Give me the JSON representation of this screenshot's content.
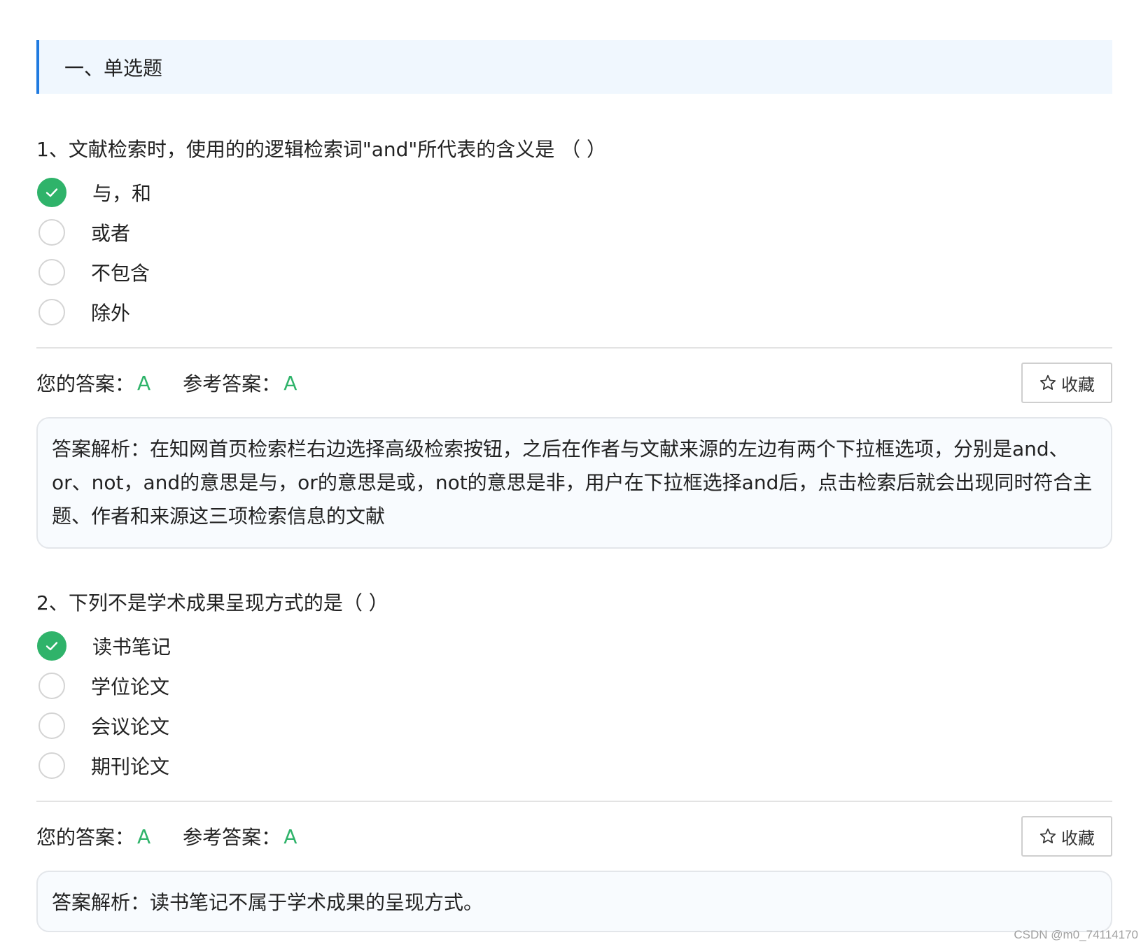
{
  "section": {
    "title": "一、单选题"
  },
  "questions": [
    {
      "title": "1、文献检索时，使用的的逻辑检索词\"and\"所代表的含义是 （ ）",
      "options": [
        "与，和",
        "或者",
        "不包含",
        "除外"
      ],
      "selected_index": 0,
      "your_answer_label": "您的答案：",
      "your_answer": "A",
      "ref_answer_label": "参考答案：",
      "ref_answer": "A",
      "favorite_label": "收藏",
      "analysis": "答案解析：在知网首页检索栏右边选择高级检索按钮，之后在作者与文献来源的左边有两个下拉框选项，分别是and、or、not，and的意思是与，or的意思是或，not的意思是非，用户在下拉框选择and后，点击检索后就会出现同时符合主题、作者和来源这三项检索信息的文献"
    },
    {
      "title": "2、下列不是学术成果呈现方式的是（ ）",
      "options": [
        "读书笔记",
        "学位论文",
        "会议论文",
        "期刊论文"
      ],
      "selected_index": 0,
      "your_answer_label": "您的答案：",
      "your_answer": "A",
      "ref_answer_label": "参考答案：",
      "ref_answer": "A",
      "favorite_label": "收藏",
      "analysis": "答案解析：读书笔记不属于学术成果的呈现方式。"
    }
  ],
  "watermark": "CSDN @m0_74114170",
  "colors": {
    "accent": "#1f7ae0",
    "correct": "#2fb36a",
    "header_bg": "#f0f7fe"
  }
}
